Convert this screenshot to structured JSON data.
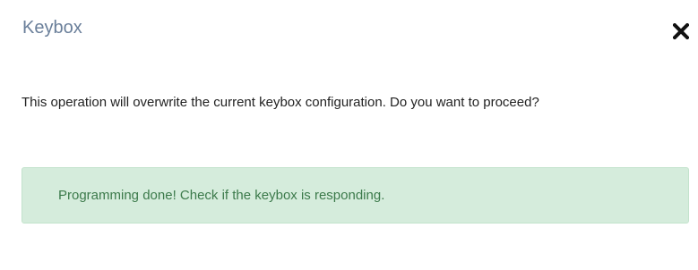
{
  "dialog": {
    "title": "Keybox",
    "close_icon": "close-icon",
    "message": "This operation will overwrite the current keybox configuration. Do you want to proceed?",
    "alert": {
      "text": "Programming done! Check if the keybox is responding.",
      "background": "#d5ecdc",
      "text_color": "#3c7a4b"
    },
    "title_color": "#6a7f9a"
  }
}
